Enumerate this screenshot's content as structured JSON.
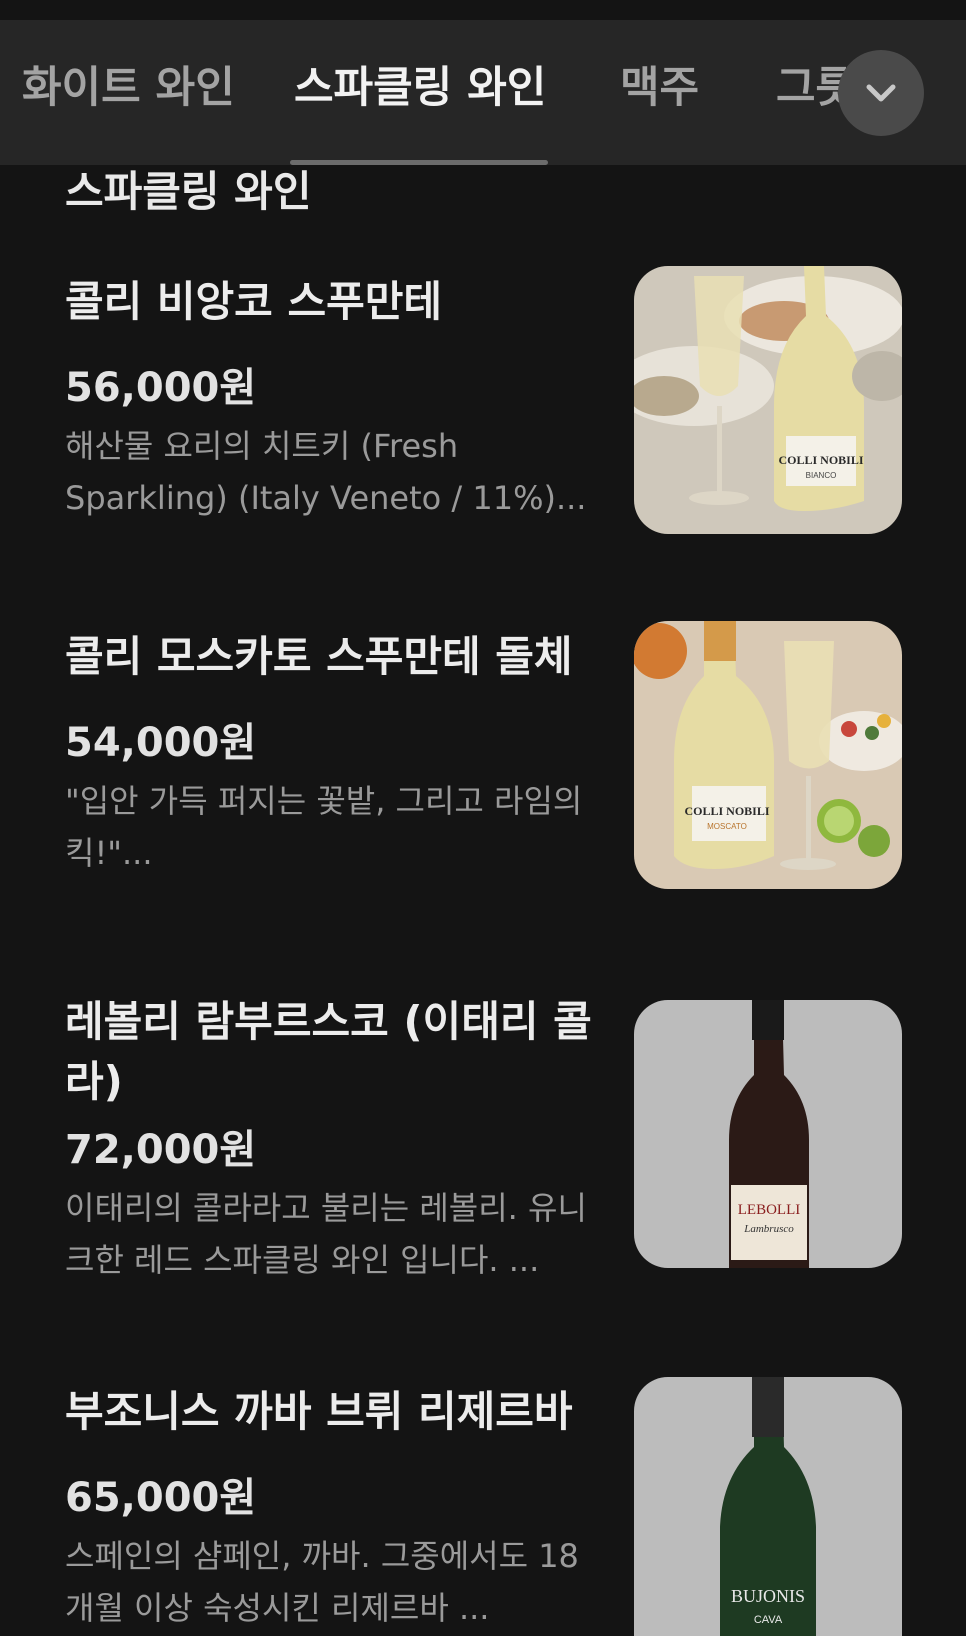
{
  "tabs": [
    {
      "label": "화이트 와인",
      "active": false
    },
    {
      "label": "스파클링 와인",
      "active": true
    },
    {
      "label": "맥주",
      "active": false
    },
    {
      "label": "그릇",
      "active": false
    }
  ],
  "expand_icon": "chevron-down-icon",
  "section": {
    "title": "스파클링 와인"
  },
  "products": [
    {
      "name": "콜리 비앙코 스푸만테",
      "price": "56,000원",
      "description": "해산물 요리의 치트키 (Fresh Sparkling) (Italy Veneto / 11%)...",
      "image": {
        "label": "COLLI NOBILI",
        "sublabel": "BIANCO"
      }
    },
    {
      "name": "콜리 모스카토 스푸만테 돌체",
      "price": "54,000원",
      "description": "\"입안 가득 퍼지는 꽃밭, 그리고 라임의 킥!\"...",
      "image": {
        "label": "COLLI NOBILI",
        "sublabel": "MOSCATO"
      }
    },
    {
      "name": "레볼리 람부르스코 (이태리 콜라)",
      "price": "72,000원",
      "description": "이태리의 콜라라고 불리는 레볼리. 유니크한 레드 스파클링 와인 입니다. ...",
      "image": {
        "label": "LEBOLLI",
        "sublabel": "Lambrusco"
      }
    },
    {
      "name": "부조니스 까바 브뤼 리제르바",
      "price": "65,000원",
      "description": "스페인의 샴페인, 까바. 그중에서도 18개월 이상 숙성시킨 리제르바 ...",
      "image": {
        "label": "BUJONIS",
        "sublabel": "CAVA"
      }
    }
  ],
  "colors": {
    "background": "#141414",
    "tabbar": "#262626",
    "text_primary": "#ececec",
    "text_secondary": "#9a9a9a"
  }
}
